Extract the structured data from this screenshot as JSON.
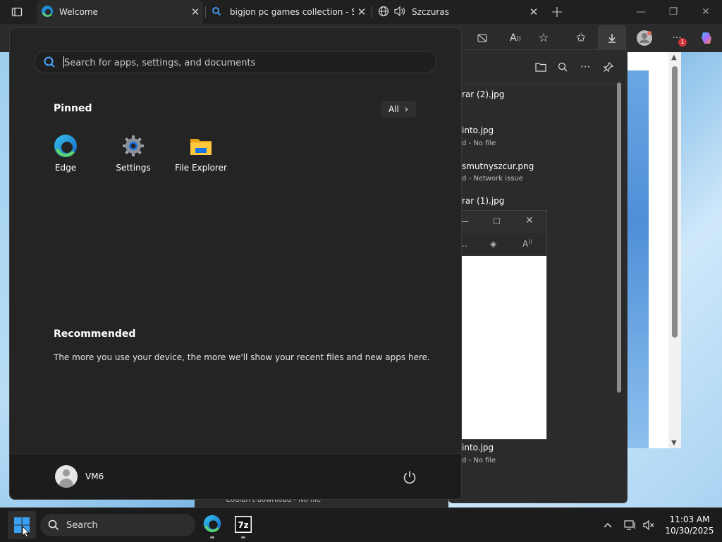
{
  "browser": {
    "tabs": [
      {
        "title": "Welcome",
        "icon": "edge-icon"
      },
      {
        "title": "bigjon pc games collection - Sear",
        "icon": "search-icon"
      },
      {
        "title": "Szczuras",
        "icon": "globe-icon"
      }
    ]
  },
  "downloads": {
    "items": [
      {
        "name": "rar (2).jpg",
        "status": ""
      },
      {
        "name": "into.jpg",
        "status": "d - No file"
      },
      {
        "name": "smutnyszcur.png",
        "status": "d - Network issue"
      },
      {
        "name": "rar (1).jpg",
        "status": ""
      },
      {
        "name": "into.jpg",
        "status": "d - No file"
      }
    ],
    "bottom_status": "Couldn't download - No file"
  },
  "start_menu": {
    "search_placeholder": "Search for apps, settings, and documents",
    "pinned_title": "Pinned",
    "all_label": "All",
    "pinned_apps": [
      {
        "label": "Edge",
        "icon": "edge-icon"
      },
      {
        "label": "Settings",
        "icon": "gear-icon"
      },
      {
        "label": "File Explorer",
        "icon": "folder-icon"
      }
    ],
    "recommended_title": "Recommended",
    "recommended_text": "The more you use your device, the more we'll show your recent files and new apps here.",
    "user_name": "VM6"
  },
  "taskbar": {
    "search_label": "Search",
    "time": "11:03 AM",
    "date": "10/30/2025",
    "notification_count": "1"
  },
  "colors": {
    "accent": "#0078d4",
    "start_bg": "#242424",
    "taskbar_bg": "#1c1c1c"
  }
}
